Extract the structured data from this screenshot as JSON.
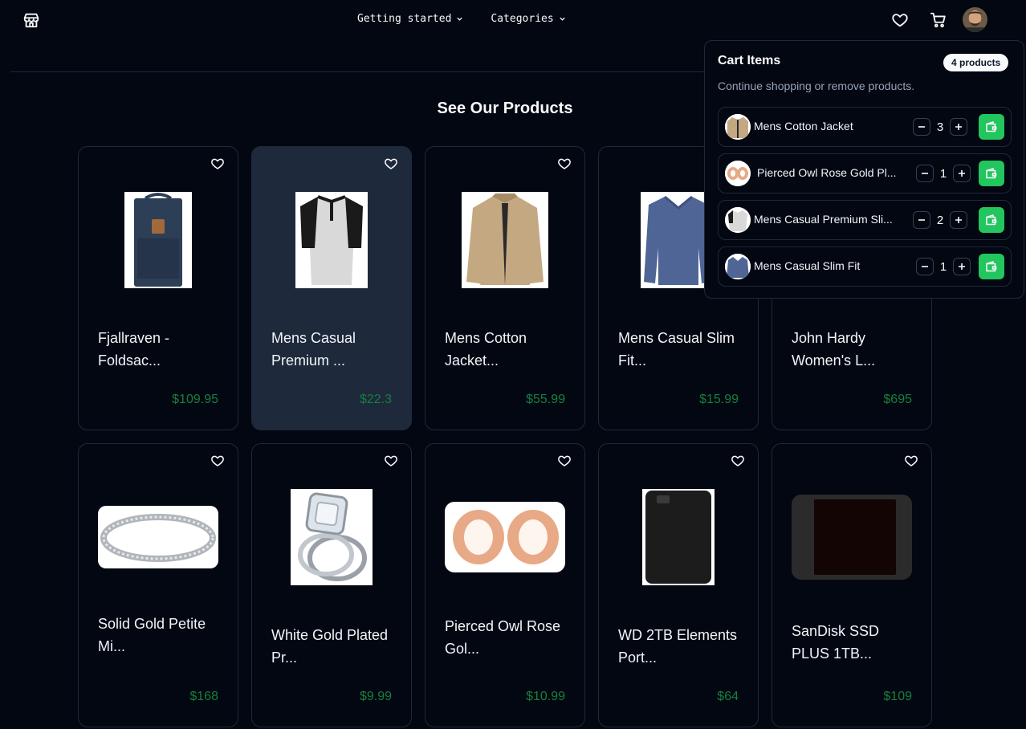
{
  "header": {
    "logo_icon": "store-icon",
    "nav": [
      {
        "label": "Getting started",
        "icon": "chevron-down-icon"
      },
      {
        "label": "Categories",
        "icon": "chevron-down-icon"
      }
    ],
    "wishlist_icon": "heart-icon",
    "cart_icon": "shopping-cart-icon"
  },
  "main": {
    "heading": "See Our Products",
    "products": [
      {
        "name": "Fjallraven - Foldsac...",
        "price": "$109.95"
      },
      {
        "name": "Mens Casual Premium ...",
        "price": "$22.3"
      },
      {
        "name": "Mens Cotton Jacket...",
        "price": "$55.99"
      },
      {
        "name": "Mens Casual Slim Fit...",
        "price": "$15.99"
      },
      {
        "name": "John Hardy Women's L...",
        "price": "$695"
      },
      {
        "name": "Solid Gold Petite Mi...",
        "price": "$168"
      },
      {
        "name": "White Gold Plated Pr...",
        "price": "$9.99"
      },
      {
        "name": "Pierced Owl Rose Gol...",
        "price": "$10.99"
      },
      {
        "name": "WD 2TB Elements Port...",
        "price": "$64"
      },
      {
        "name": "SanDisk SSD PLUS 1TB...",
        "price": "$109"
      }
    ]
  },
  "cart": {
    "title": "Cart Items",
    "badge": "4 products",
    "subtitle": "Continue shopping or remove products.",
    "items": [
      {
        "name": "Mens Cotton Jacket",
        "qty": "3"
      },
      {
        "name": "Pierced Owl Rose Gold Pl...",
        "qty": "1"
      },
      {
        "name": "Mens Casual Premium Sli...",
        "qty": "2"
      },
      {
        "name": "Mens Casual Slim Fit",
        "qty": "1"
      }
    ]
  },
  "colors": {
    "background": "#030711",
    "border": "#1e293b",
    "price": "#15803d",
    "accent": "#22c55e",
    "active_card": "#1e293b"
  }
}
